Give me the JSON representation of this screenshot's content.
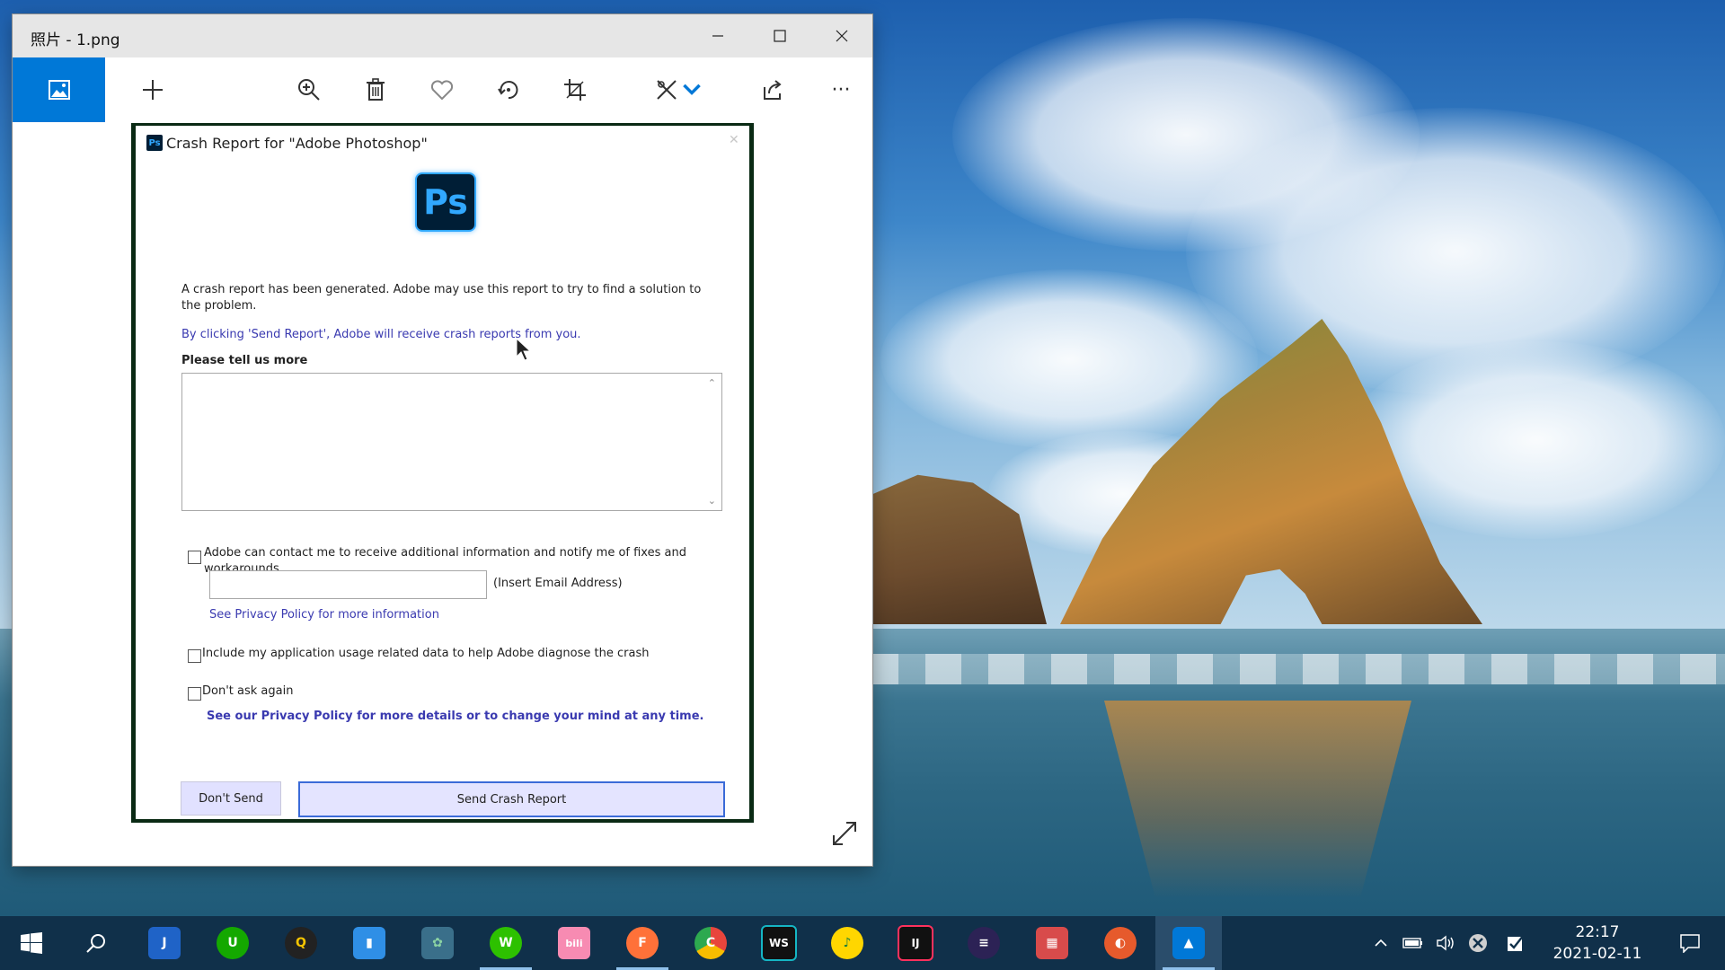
{
  "window": {
    "title": "照片 - 1.png",
    "controls": {
      "minimize": "—",
      "maximize": "☐",
      "close": "✕"
    }
  },
  "toolbar": {
    "icons": [
      "photo-icon",
      "add-icon",
      "zoom-in-icon",
      "delete-icon",
      "favorite-icon",
      "rotate-icon",
      "crop-icon",
      "edit-draw-icon",
      "share-icon",
      "more-icon"
    ],
    "more_label": "···"
  },
  "crash_dialog": {
    "title": "Crash Report for \"Adobe Photoshop\"",
    "logo_text": "Ps",
    "intro_text": "A crash report has been generated. Adobe may use this report to try to find a solution to the problem.",
    "send_notice": "By clicking 'Send Report', Adobe will receive crash reports from you.",
    "tell_more_label": "Please tell us more",
    "contact_label": "Adobe can contact me to receive additional information and notify me of fixes and workarounds.",
    "email_hint": "(Insert Email Address)",
    "privacy_link": "See Privacy Policy for more information",
    "usage_label": "Include my application usage related data to help Adobe diagnose the crash",
    "dont_ask_label": "Don't ask again",
    "privacy_details_link": "See our Privacy Policy for more details or to change your mind at any time.",
    "dont_send_button": "Don't Send",
    "send_button": "Send Crash Report"
  },
  "taskbar": {
    "apps": [
      {
        "name": "cortana",
        "glyph": "J",
        "color": "#1f63c7"
      },
      {
        "name": "upwork",
        "glyph": "U",
        "color": "#14a800"
      },
      {
        "name": "qq",
        "glyph": "Q",
        "color": "#f5c400"
      },
      {
        "name": "notes",
        "glyph": "▮",
        "color": "#2f8fe6"
      },
      {
        "name": "settings",
        "glyph": "✿",
        "color": "#8bd3a3"
      },
      {
        "name": "wechat",
        "glyph": "W",
        "color": "#2dc100"
      },
      {
        "name": "bilibili",
        "glyph": "bili",
        "color": "#f78bb2"
      },
      {
        "name": "firefox",
        "glyph": "F",
        "color": "#ff7139"
      },
      {
        "name": "chrome",
        "glyph": "C",
        "color": "#e8453c"
      },
      {
        "name": "webstorm",
        "glyph": "WS",
        "color": "#15b6c4"
      },
      {
        "name": "music",
        "glyph": "♪",
        "color": "#ffd600"
      },
      {
        "name": "intellij",
        "glyph": "IJ",
        "color": "#222222"
      },
      {
        "name": "eclipse",
        "glyph": "≡",
        "color": "#2c2255"
      },
      {
        "name": "apps",
        "glyph": "▦",
        "color": "#d84b4b"
      },
      {
        "name": "color-tool",
        "glyph": "◐",
        "color": "#e65a2c"
      },
      {
        "name": "photos",
        "glyph": "▲",
        "color": "#0078d7"
      }
    ],
    "clock_time": "22:17",
    "clock_date": "2021-02-11"
  }
}
